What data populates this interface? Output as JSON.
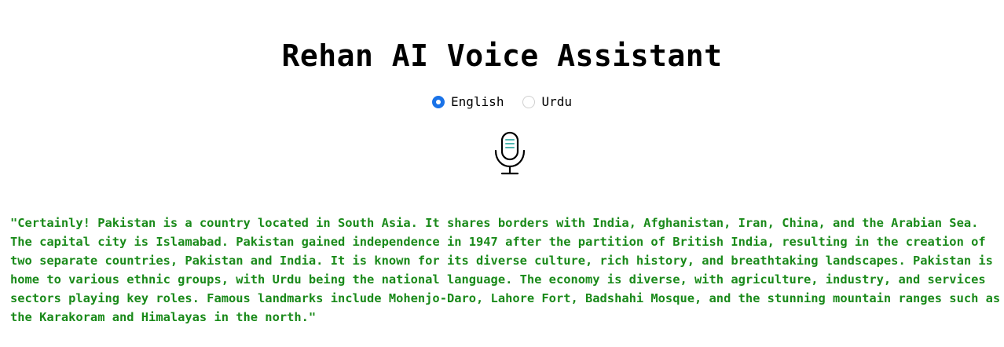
{
  "app": {
    "title": "Rehan AI Voice Assistant"
  },
  "language": {
    "options": [
      {
        "label": "English",
        "selected": true
      },
      {
        "label": "Urdu",
        "selected": false
      }
    ],
    "accent_color": "#1a73e8"
  },
  "mic": {
    "icon": "microphone-icon"
  },
  "response": {
    "text": "\"Certainly! Pakistan is a country located in South Asia. It shares borders with India, Afghanistan, Iran, China, and the Arabian Sea. The capital city is Islamabad. Pakistan gained independence in 1947 after the partition of British India, resulting in the creation of two separate countries, Pakistan and India. It is known for its diverse culture, rich history, and breathtaking landscapes. Pakistan is home to various ethnic groups, with Urdu being the national language. The economy is diverse, with agriculture, industry, and services sectors playing key roles. Famous landmarks include Mohenjo-Daro, Lahore Fort, Badshahi Mosque, and the stunning mountain ranges such as the Karakoram and Himalayas in the north.\"",
    "color": "#1a8a1a"
  }
}
